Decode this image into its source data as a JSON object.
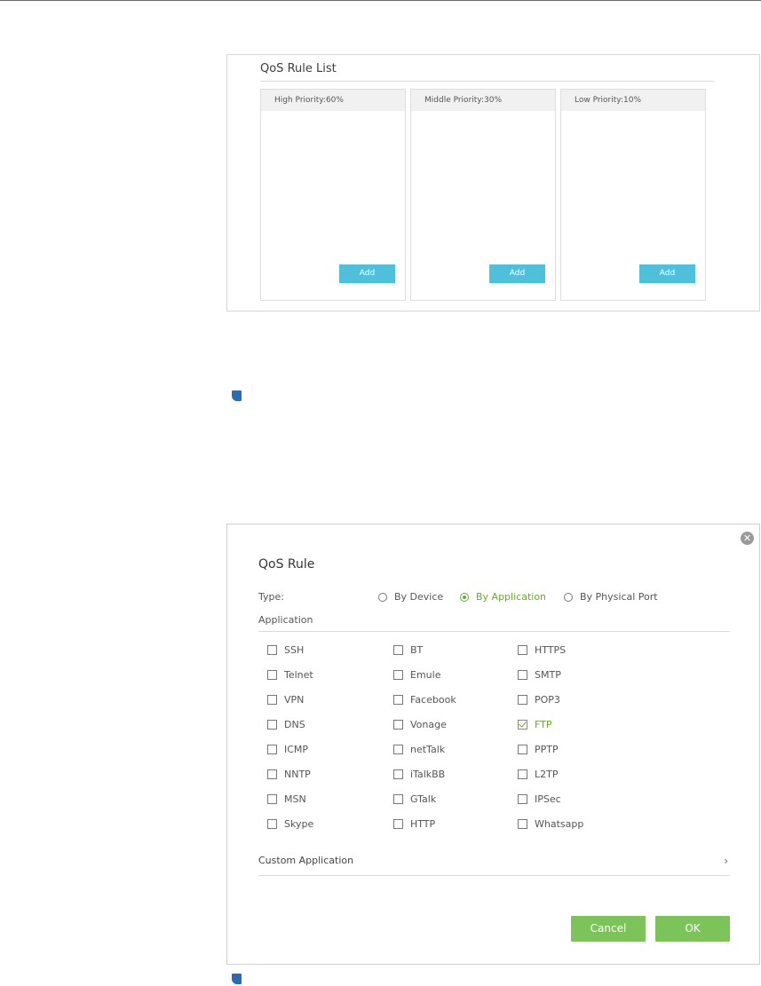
{
  "rule_list": {
    "title": "QoS Rule List",
    "columns": [
      {
        "header": "High Priority:60%",
        "add_label": "Add"
      },
      {
        "header": "Middle Priority:30%",
        "add_label": "Add"
      },
      {
        "header": "Low Priority:10%",
        "add_label": "Add"
      }
    ]
  },
  "dialog": {
    "title": "QoS Rule",
    "close_glyph": "✕",
    "type_label": "Type:",
    "type_options": [
      {
        "label": "By Device",
        "selected": false
      },
      {
        "label": "By Application",
        "selected": true
      },
      {
        "label": "By Physical Port",
        "selected": false
      }
    ],
    "application_label": "Application",
    "applications": [
      [
        {
          "label": "SSH",
          "checked": false
        },
        {
          "label": "Telnet",
          "checked": false
        },
        {
          "label": "VPN",
          "checked": false
        },
        {
          "label": "DNS",
          "checked": false
        },
        {
          "label": "ICMP",
          "checked": false
        },
        {
          "label": "NNTP",
          "checked": false
        },
        {
          "label": "MSN",
          "checked": false
        },
        {
          "label": "Skype",
          "checked": false
        }
      ],
      [
        {
          "label": "BT",
          "checked": false
        },
        {
          "label": "Emule",
          "checked": false
        },
        {
          "label": "Facebook",
          "checked": false
        },
        {
          "label": "Vonage",
          "checked": false
        },
        {
          "label": "netTalk",
          "checked": false
        },
        {
          "label": "iTalkBB",
          "checked": false
        },
        {
          "label": "GTalk",
          "checked": false
        },
        {
          "label": "HTTP",
          "checked": false
        }
      ],
      [
        {
          "label": "HTTPS",
          "checked": false
        },
        {
          "label": "SMTP",
          "checked": false
        },
        {
          "label": "POP3",
          "checked": false
        },
        {
          "label": "FTP",
          "checked": true
        },
        {
          "label": "PPTP",
          "checked": false
        },
        {
          "label": "L2TP",
          "checked": false
        },
        {
          "label": "IPSec",
          "checked": false
        },
        {
          "label": "Whatsapp",
          "checked": false
        }
      ]
    ],
    "custom_application_label": "Custom Application",
    "chevron_glyph": "›",
    "cancel_label": "Cancel",
    "ok_label": "OK"
  },
  "colors": {
    "add_button": "#4fc0dc",
    "accent_green": "#6aaa2e",
    "action_button": "#7cc35a",
    "note_marker": "#2b6cb0"
  },
  "icons": [
    "note-icon",
    "close-icon",
    "chevron-right-icon",
    "radio-icon",
    "checkbox-icon"
  ]
}
